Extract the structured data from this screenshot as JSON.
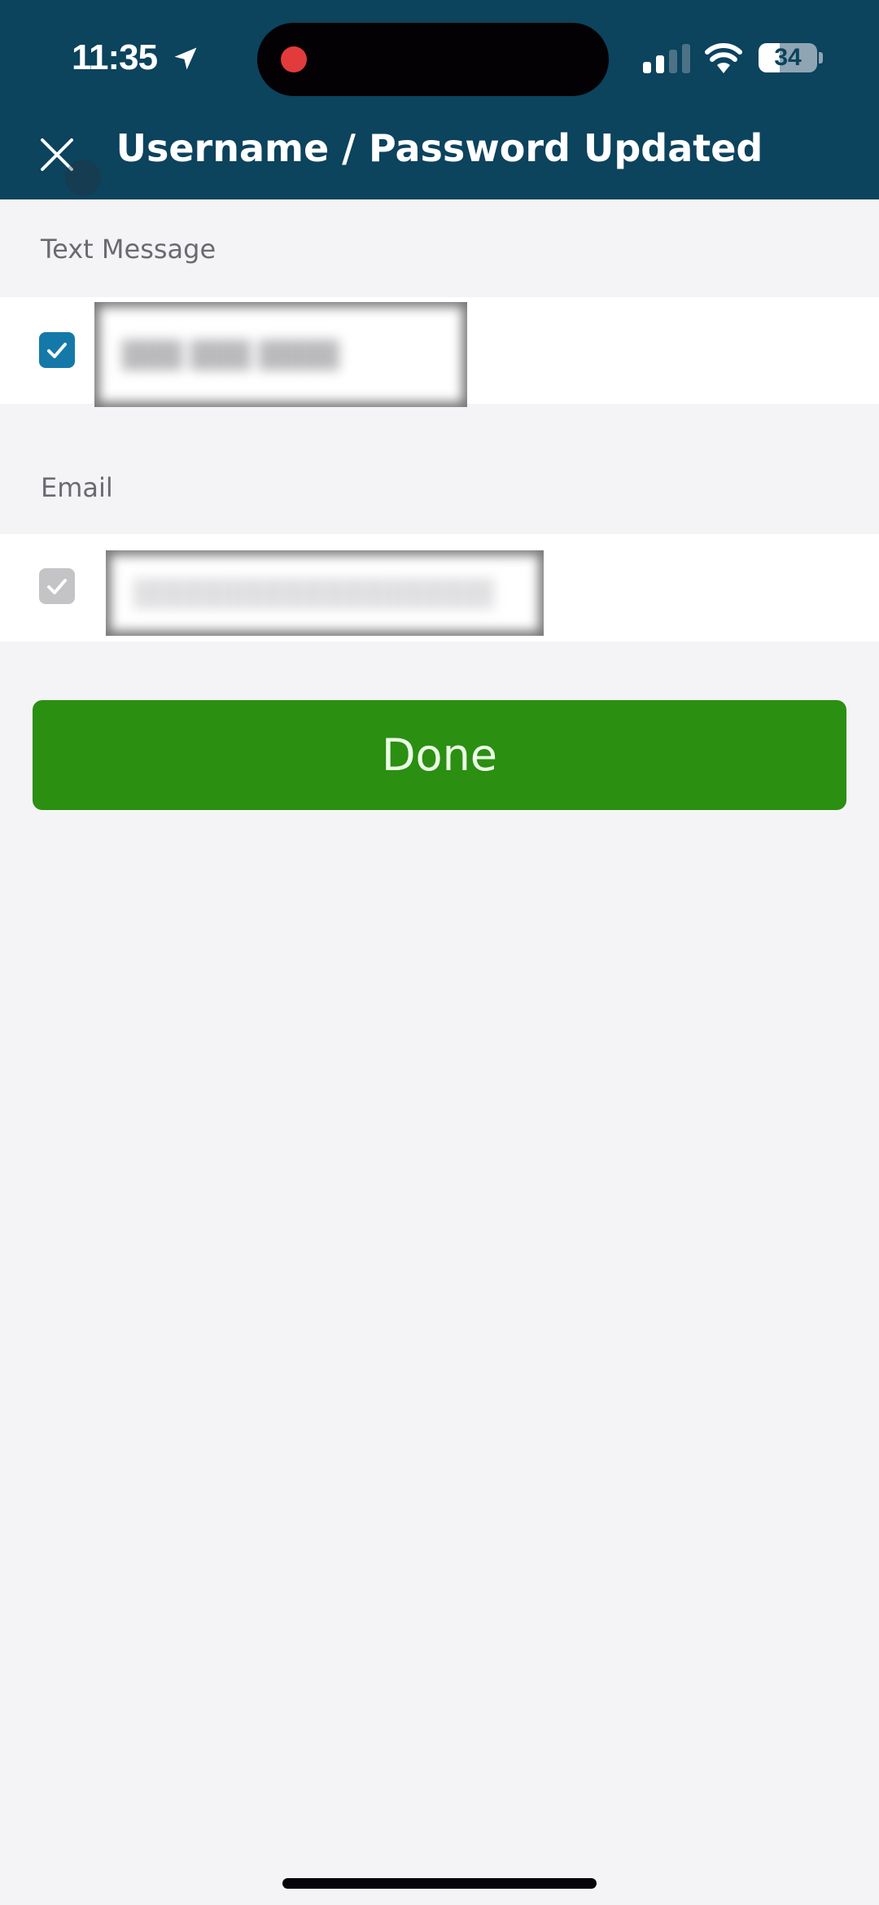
{
  "status_bar": {
    "time": "11:35",
    "location_icon": "location-arrow-icon",
    "recording_indicator": "screen-recording-dot",
    "signal_bars_active": 2,
    "signal_bars_total": 4,
    "wifi_icon": "wifi-icon",
    "battery_percent": "34",
    "battery_level": 0.34
  },
  "header": {
    "title": "Username / Password Updated",
    "close_icon": "close-icon",
    "background_color": "#0c435d"
  },
  "sections": [
    {
      "label": "Text Message",
      "checked": true,
      "enabled": true,
      "value_redacted": true
    },
    {
      "label": "Email",
      "checked": true,
      "enabled": false,
      "value_redacted": true
    }
  ],
  "done_button": {
    "label": "Done",
    "color": "#2b8f12"
  },
  "colors": {
    "checkbox_active": "#1479a8",
    "checkbox_disabled": "#c4c4c6",
    "page_background": "#f4f4f7",
    "recording_dot": "#e23b3b"
  }
}
